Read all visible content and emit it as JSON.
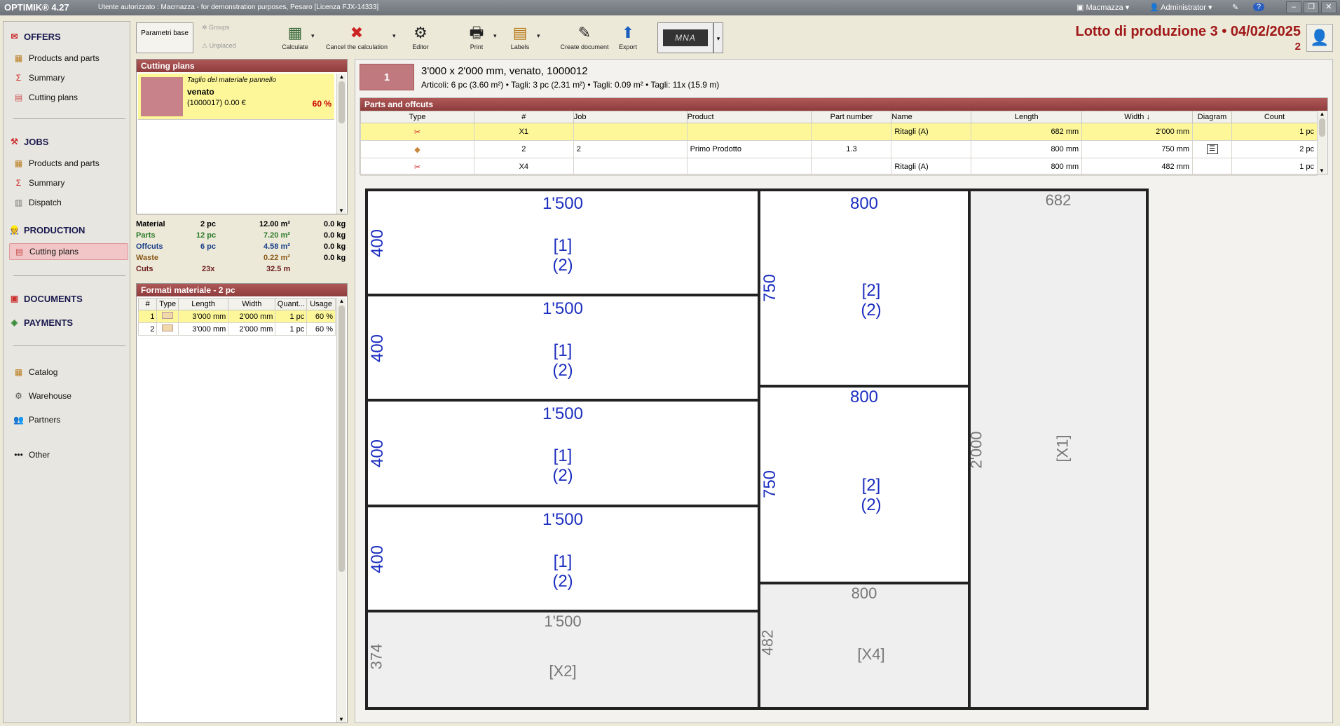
{
  "titlebar": {
    "app": "OPTIMIK® 4.27",
    "license": "Utente autorizzato : Macmazza - for demonstration purposes, Pesaro  [Licenza FJX-14333]",
    "company": "Macmazza",
    "user": "Administrator",
    "help": "?"
  },
  "sidebar": {
    "offers": {
      "title": "OFFERS",
      "items": [
        "Products and parts",
        "Summary",
        "Cutting plans"
      ]
    },
    "jobs": {
      "title": "JOBS",
      "items": [
        "Products and parts",
        "Summary",
        "Dispatch"
      ]
    },
    "production": {
      "title": "PRODUCTION",
      "items": [
        "Cutting plans"
      ]
    },
    "documents": "DOCUMENTS",
    "payments": "PAYMENTS",
    "catalog": "Catalog",
    "warehouse": "Warehouse",
    "partners": "Partners",
    "other": "Other"
  },
  "toolbar": {
    "param": "Parametri base",
    "groups": "Groups",
    "unplaced": "Unplaced",
    "calculate": "Calculate",
    "cancel": "Cancel the calculation",
    "editor": "Editor",
    "print": "Print",
    "labels": "Labels",
    "create_document": "Create document",
    "export": "Export",
    "logo": "MNA"
  },
  "header": {
    "title": "Lotto di produzione 3  •  04/02/2025",
    "subtitle": "2"
  },
  "cutting_plans": {
    "title": "Cutting plans",
    "card": {
      "subtitle": "Taglio del materiale pannello",
      "name": "venato",
      "code": "(1000017)  0.00 €",
      "usage": "60 %",
      "color": "#c8838a"
    }
  },
  "stats": [
    {
      "label": "Material",
      "count": "2 pc",
      "area": "12.00 m²",
      "weight": "0.0 kg",
      "color": "#000000"
    },
    {
      "label": "Parts",
      "count": "12 pc",
      "area": "7.20 m²",
      "weight": "0.0 kg",
      "color": "#2a7a2a"
    },
    {
      "label": "Offcuts",
      "count": "6 pc",
      "area": "4.58 m²",
      "weight": "0.0 kg",
      "color": "#1a3f8a"
    },
    {
      "label": "Waste",
      "count": "",
      "area": "0.22 m²",
      "weight": "0.0 kg",
      "color": "#8a5a1a"
    },
    {
      "label": "Cuts",
      "count": "23x",
      "area": "32.5 m",
      "weight": "",
      "color": "#6a1a1a"
    }
  ],
  "formats": {
    "title": "Formati materiale - 2 pc",
    "headers": [
      "#",
      "Type",
      "Length",
      "Width",
      "Quant...",
      "Usage"
    ],
    "rows": [
      [
        "1",
        "",
        "3'000 mm",
        "2'000 mm",
        "1 pc",
        "60 %"
      ],
      [
        "2",
        "",
        "3'000 mm",
        "2'000 mm",
        "1 pc",
        "60 %"
      ]
    ]
  },
  "sheet": {
    "number": "1",
    "title": "3'000 x 2'000 mm, venato, 1000012",
    "info": "Articoli: 6 pc  (3.60 m²)    •    Tagli: 3 pc  (2.31 m²)    •    Tagli: 0.09 m²    •    Tagli: 11x  (15.9 m)"
  },
  "parts_offcuts": {
    "title": "Parts and offcuts",
    "headers": [
      "Type",
      "#",
      "Job",
      "Product",
      "Part number",
      "Name",
      "Length",
      "Width",
      "Diagram",
      "Count"
    ],
    "rows": [
      {
        "type": "scissors",
        "num": "X1",
        "job": "",
        "product": "",
        "part": "",
        "name": "Ritagli (A)",
        "length": "682 mm",
        "width": "2'000 mm",
        "count": "1 pc"
      },
      {
        "type": "board",
        "num": "2",
        "job": "2",
        "product": "Primo Prodotto",
        "part": "1.3",
        "name": "",
        "length": "800 mm",
        "width": "750 mm",
        "count": "2 pc"
      },
      {
        "type": "scissors",
        "num": "X4",
        "job": "",
        "product": "",
        "part": "",
        "name": "Ritagli (A)",
        "length": "800 mm",
        "width": "482 mm",
        "count": "1 pc"
      }
    ]
  },
  "pieces": [
    {
      "top": "1'500",
      "side": "400",
      "id": "[1]",
      "qty": "(2)"
    },
    {
      "top": "1'500",
      "side": "400",
      "id": "[1]",
      "qty": "(2)"
    },
    {
      "top": "1'500",
      "side": "400",
      "id": "[1]",
      "qty": "(2)"
    },
    {
      "top": "1'500",
      "side": "400",
      "id": "[1]",
      "qty": "(2)"
    },
    {
      "top": "1'500",
      "side": "374",
      "id": "[X2]",
      "qty": ""
    },
    {
      "top": "800",
      "side": "750",
      "id": "[2]",
      "qty": "(2)"
    },
    {
      "top": "800",
      "side": "750",
      "id": "[2]",
      "qty": "(2)"
    },
    {
      "top": "800",
      "side": "482",
      "id": "[X4]",
      "qty": ""
    },
    {
      "top": "682",
      "side": "2'000",
      "id": "[X1]",
      "qty": ""
    }
  ]
}
